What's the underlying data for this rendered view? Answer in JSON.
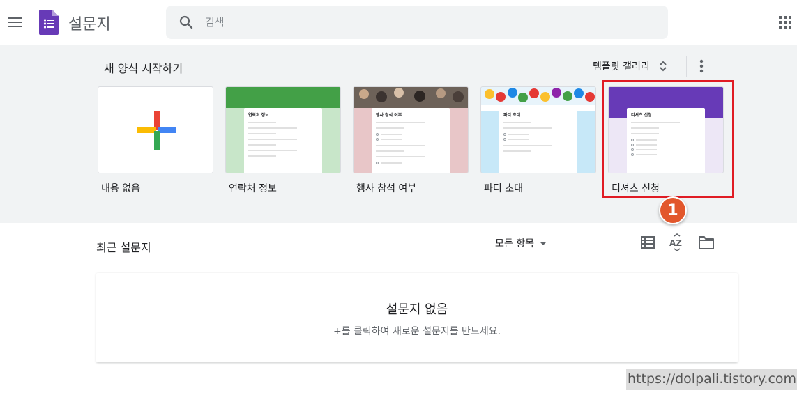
{
  "header": {
    "app_title": "설문지",
    "search_placeholder": "검색",
    "icons": [
      "menu-icon",
      "forms-logo",
      "search-icon",
      "apps-grid-icon"
    ]
  },
  "gallery": {
    "heading": "새 양식 시작하기",
    "toggle_label": "템플릿 갤러리",
    "templates": [
      {
        "name": "내용 없음",
        "thumb_title": ""
      },
      {
        "name": "연락처 정보",
        "thumb_title": "연락처 정보"
      },
      {
        "name": "행사 참석 여부",
        "thumb_title": "행사 참석 여부"
      },
      {
        "name": "파티 초대",
        "thumb_title": "파티 초대"
      },
      {
        "name": "티셔츠 신청",
        "thumb_title": "티셔츠 신청"
      }
    ]
  },
  "annotation": {
    "step_number": "1",
    "highlight_color": "#e01b24",
    "badge_color": "#e2572c"
  },
  "recent": {
    "title": "최근 설문지",
    "owner_filter": "모든 항목",
    "empty_title": "설문지 없음",
    "empty_subtitle": "+를 클릭하여 새로운 설문지를 만드세요."
  },
  "watermark": "https://dolpali.tistory.com",
  "colors": {
    "forms_purple": "#673ab7",
    "gallery_bg": "#f1f3f4",
    "contact_green": "#43a047",
    "rsvp_pink": "#e8c6c8",
    "party_blue": "#c7e8f8",
    "tshirt_purple": "#673ab7"
  }
}
